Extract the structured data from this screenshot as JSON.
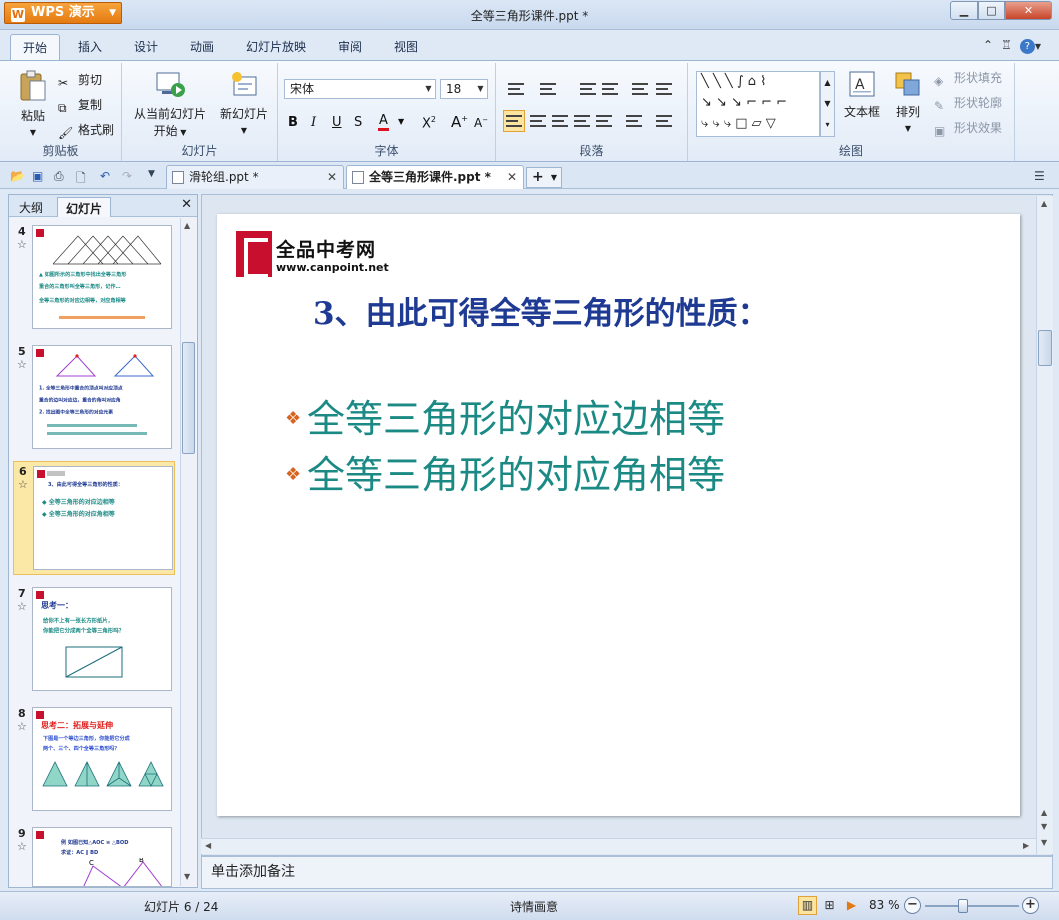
{
  "app": {
    "name": "WPS 演示",
    "title": "全等三角形课件.ppt *"
  },
  "window_controls": {
    "minimize": "▁",
    "maximize": "□",
    "close": "✕"
  },
  "ribbon_tabs": [
    "开始",
    "插入",
    "设计",
    "动画",
    "幻灯片放映",
    "审阅",
    "视图"
  ],
  "ribbon": {
    "clipboard": {
      "paste": "粘贴",
      "cut": "剪切",
      "copy": "复制",
      "format_painter": "格式刷",
      "label": "剪贴板"
    },
    "slides": {
      "from_current": "从当前幻灯片",
      "start": "开始",
      "new_slide": "新幻灯片",
      "label": "幻灯片"
    },
    "font": {
      "name": "宋体",
      "size": "18",
      "label": "字体"
    },
    "paragraph": {
      "label": "段落"
    },
    "drawing": {
      "textbox": "文本框",
      "arrange": "排列",
      "shape_fill": "形状填充",
      "shape_outline": "形状轮廓",
      "shape_effects": "形状效果",
      "label": "绘图"
    }
  },
  "doc_tabs": [
    {
      "label": "滑轮组.ppt *",
      "active": false
    },
    {
      "label": "全等三角形课件.ppt *",
      "active": true
    }
  ],
  "left_pane": {
    "tabs": [
      "大纲",
      "幻灯片"
    ],
    "close": "✕",
    "slides": [
      {
        "num": "4",
        "star": "☆",
        "selected": false,
        "lines": [
          "▲ 如图所示的三角形中找出全等三角形",
          "重合的三角形叫全等三角形，记作…",
          "全等三角形的对应边相等，对应角相等"
        ]
      },
      {
        "num": "5",
        "star": "☆",
        "selected": false,
        "lines": [
          "1. 全等三角形中重合的顶点叫对应顶点",
          "重合的边叫对应边，重合的角叫对应角",
          "2. 找出图中全等三角形的对应元素"
        ]
      },
      {
        "num": "6",
        "star": "☆",
        "selected": true,
        "lines": [
          "3、由此可得全等三角形的性质：",
          "◆ 全等三角形的对应边相等",
          "◆ 全等三角形的对应角相等"
        ]
      },
      {
        "num": "7",
        "star": "☆",
        "selected": false,
        "lines": [
          "思考一：",
          "给你不上有一张长方形纸片，",
          "你能把它分成两个全等三角形吗？"
        ]
      },
      {
        "num": "8",
        "star": "☆",
        "selected": false,
        "lines": [
          "思考二：拓展与延伸",
          "下图是一个等边三角形，你能把它分成",
          "两个、三个、四个全等三角形吗？"
        ]
      },
      {
        "num": "9",
        "star": "☆",
        "selected": false,
        "lines": [
          "例  如图已知△AOC ≌ △BOD",
          "求证：AC ∥ BD"
        ]
      }
    ]
  },
  "slide": {
    "logo_text": "全品中考网",
    "logo_url": "www.canpoint.net",
    "title": "3、由此可得全等三角形的性质：",
    "bullets": [
      "全等三角形的对应边相等",
      "全等三角形的对应角相等"
    ],
    "bullet_symbol": "❖",
    "colors": {
      "title": "#1f3a93",
      "bullet_text": "#1b8a85",
      "bullet_symbol": "#d8631c",
      "logo": "#c8102e"
    }
  },
  "notes": {
    "placeholder": "单击添加备注"
  },
  "status": {
    "slide_counter": "幻灯片 6 / 24",
    "theme": "诗情画意",
    "zoom": "83 %",
    "zoom_minus": "−",
    "zoom_plus": "+"
  }
}
